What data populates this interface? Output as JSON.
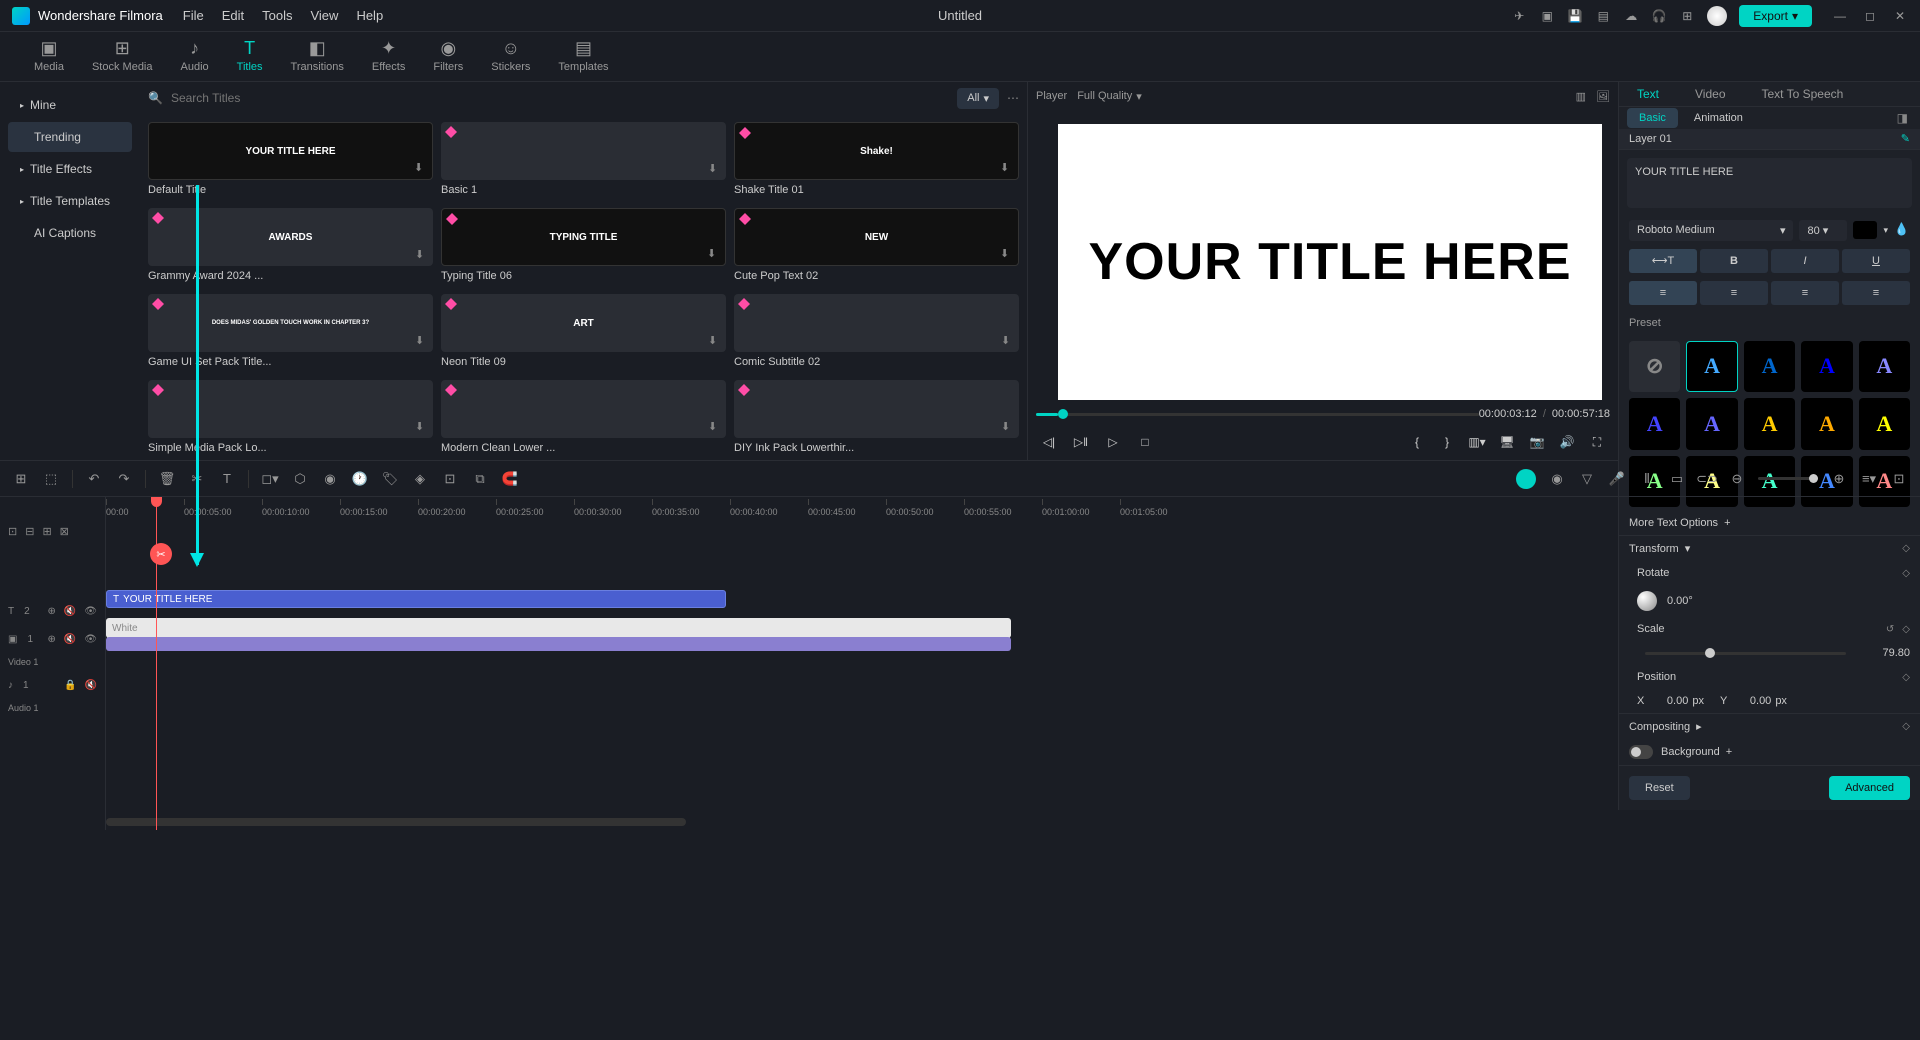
{
  "app": {
    "name": "Wondershare Filmora",
    "document": "Untitled"
  },
  "menu": [
    "File",
    "Edit",
    "Tools",
    "View",
    "Help"
  ],
  "export_label": "Export",
  "media_tabs": [
    {
      "label": "Media",
      "icon": "▣"
    },
    {
      "label": "Stock Media",
      "icon": "⊞"
    },
    {
      "label": "Audio",
      "icon": "♪"
    },
    {
      "label": "Titles",
      "icon": "T",
      "active": true
    },
    {
      "label": "Transitions",
      "icon": "◧"
    },
    {
      "label": "Effects",
      "icon": "✦"
    },
    {
      "label": "Filters",
      "icon": "◉"
    },
    {
      "label": "Stickers",
      "icon": "☺"
    },
    {
      "label": "Templates",
      "icon": "▤"
    }
  ],
  "sidebar": {
    "items": [
      {
        "label": "Mine",
        "expandable": true
      },
      {
        "label": "Trending",
        "active": true
      },
      {
        "label": "Title Effects",
        "expandable": true
      },
      {
        "label": "Title Templates",
        "expandable": true
      },
      {
        "label": "AI Captions"
      }
    ]
  },
  "browser": {
    "search_placeholder": "Search Titles",
    "filter": "All",
    "cards": [
      {
        "label": "Default Title",
        "preview": "YOUR TITLE HERE",
        "selected": true
      },
      {
        "label": "Basic 1",
        "preview": "",
        "premium": true
      },
      {
        "label": "Shake Title 01",
        "preview": "Shake!",
        "premium": true
      },
      {
        "label": "Grammy Award 2024 ...",
        "preview": "AWARDS",
        "premium": true
      },
      {
        "label": "Typing Title 06",
        "preview": "TYPING TITLE",
        "premium": true
      },
      {
        "label": "Cute Pop Text 02",
        "preview": "NEW",
        "premium": true
      },
      {
        "label": "Game UI Set Pack Title...",
        "preview": "DOES MIDAS' GOLDEN TOUCH WORK IN CHAPTER 3?",
        "premium": true
      },
      {
        "label": "Neon Title 09",
        "preview": "ART",
        "premium": true
      },
      {
        "label": "Comic Subtitle 02",
        "preview": "",
        "premium": true
      },
      {
        "label": "Simple Media Pack Lo...",
        "preview": "",
        "premium": true
      },
      {
        "label": "Modern Clean Lower ...",
        "preview": "",
        "premium": true
      },
      {
        "label": "DIY Ink Pack Lowerthir...",
        "preview": "",
        "premium": true
      }
    ]
  },
  "player": {
    "label": "Player",
    "quality": "Full Quality",
    "canvas_text": "YOUR TITLE HERE",
    "timecode_current": "00:00:03:12",
    "timecode_total": "00:00:57:18"
  },
  "inspector": {
    "tabs": [
      "Text",
      "Video",
      "Text To Speech"
    ],
    "active_tab": "Text",
    "subtabs": [
      "Basic",
      "Animation"
    ],
    "active_subtab": "Basic",
    "layer": "Layer 01",
    "text_value": "YOUR TITLE HERE",
    "font": "Roboto Medium",
    "size": "80",
    "preset_label": "Preset",
    "more_text": "More Text Options",
    "transform_label": "Transform",
    "rotate_label": "Rotate",
    "rotate_value": "0.00°",
    "scale_label": "Scale",
    "scale_value": "79.80",
    "position_label": "Position",
    "pos_x": "0.00",
    "pos_y": "0.00",
    "px": "px",
    "compositing_label": "Compositing",
    "background_label": "Background",
    "reset": "Reset",
    "advanced": "Advanced"
  },
  "timeline": {
    "ticks": [
      "00:00",
      "00:00:05:00",
      "00:00:10:00",
      "00:00:15:00",
      "00:00:20:00",
      "00:00:25:00",
      "00:00:30:00",
      "00:00:35:00",
      "00:00:40:00",
      "00:00:45:00",
      "00:00:50:00",
      "00:00:55:00",
      "00:01:00:00",
      "00:01:05:00"
    ],
    "title_clip": "YOUR TITLE HERE",
    "video_clip": "White",
    "track_video": "Video 1",
    "track_audio": "Audio 1",
    "track_t2": "2",
    "track_t1": "1",
    "track_a1": "1"
  }
}
